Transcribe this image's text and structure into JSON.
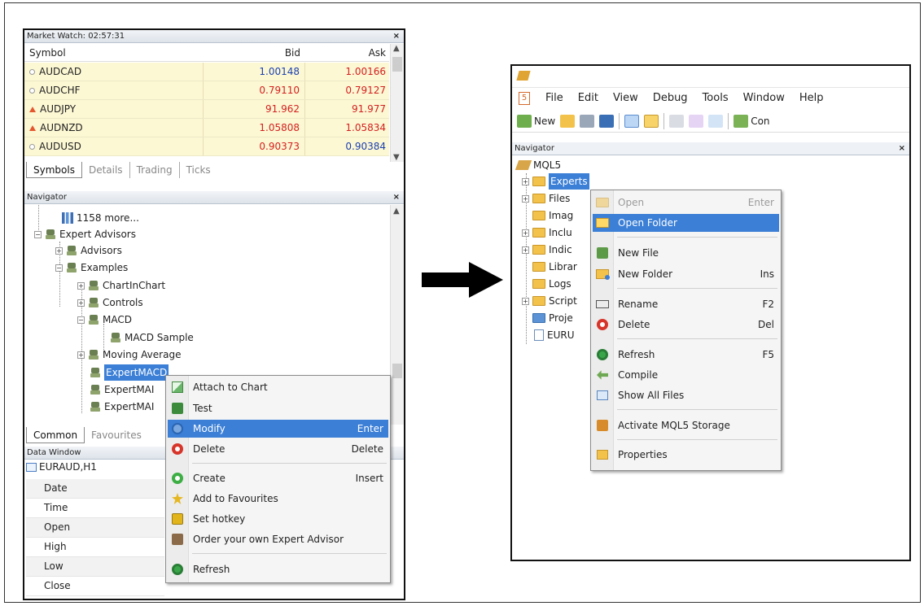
{
  "left": {
    "market_watch": {
      "title": "Market Watch: 02:57:31",
      "close": "×",
      "columns": [
        "Symbol",
        "Bid",
        "Ask"
      ],
      "rows": [
        {
          "symbol": "AUDCAD",
          "bid": "1.00148",
          "ask": "1.00166",
          "bid_color": "#1a3fb0",
          "ask_color": "#d32020",
          "indicator": "neutral"
        },
        {
          "symbol": "AUDCHF",
          "bid": "0.79110",
          "ask": "0.79127",
          "bid_color": "#d32020",
          "ask_color": "#d32020",
          "indicator": "neutral"
        },
        {
          "symbol": "AUDJPY",
          "bid": "91.962",
          "ask": "91.977",
          "bid_color": "#d32020",
          "ask_color": "#d32020",
          "indicator": "up"
        },
        {
          "symbol": "AUDNZD",
          "bid": "1.05808",
          "ask": "1.05834",
          "bid_color": "#d32020",
          "ask_color": "#d32020",
          "indicator": "up"
        },
        {
          "symbol": "AUDUSD",
          "bid": "0.90373",
          "ask": "0.90384",
          "bid_color": "#d32020",
          "ask_color": "#1a3fb0",
          "indicator": "neutral"
        }
      ],
      "tabs": [
        "Symbols",
        "Details",
        "Trading",
        "Ticks"
      ],
      "active_tab": "Symbols"
    },
    "navigator": {
      "title": "Navigator",
      "close": "×",
      "tree": {
        "more": "1158 more...",
        "expert_advisors": "Expert Advisors",
        "advisors": "Advisors",
        "examples": "Examples",
        "chartinchart": "ChartInChart",
        "controls": "Controls",
        "macd": "MACD",
        "macd_sample": "MACD Sample",
        "moving_average": "Moving Average",
        "expertmacd": "ExpertMACD",
        "expertma1": "ExpertMAI",
        "expertma2": "ExpertMAI"
      },
      "tabs": [
        "Common",
        "Favourites"
      ]
    },
    "data_window": {
      "title": "Data Window",
      "symbol": "EURAUD,H1",
      "rows": [
        "Date",
        "Time",
        "Open",
        "High",
        "Low",
        "Close"
      ]
    },
    "context_menu": {
      "items": [
        {
          "label": "Attach to Chart",
          "key": "",
          "icon": "attach-chart-icon"
        },
        {
          "label": "Test",
          "key": "",
          "icon": "test-icon"
        },
        {
          "label": "Modify",
          "key": "Enter",
          "icon": "modify-icon",
          "highlighted": true
        },
        {
          "label": "Delete",
          "key": "Delete",
          "icon": "delete-icon"
        },
        {
          "label": "Create",
          "key": "Insert",
          "icon": "create-icon"
        },
        {
          "label": "Add to Favourites",
          "key": "",
          "icon": "favourites-icon"
        },
        {
          "label": "Set hotkey",
          "key": "",
          "icon": "hotkey-icon"
        },
        {
          "label": "Order your own Expert Advisor",
          "key": "",
          "icon": "order-icon"
        },
        {
          "label": "Refresh",
          "key": "",
          "icon": "refresh-icon"
        }
      ]
    }
  },
  "right": {
    "menubar": [
      "File",
      "Edit",
      "View",
      "Debug",
      "Tools",
      "Window",
      "Help"
    ],
    "toolbar": {
      "new_label": "New",
      "compile_label": "Con"
    },
    "navigator": {
      "title": "Navigator",
      "close": "×",
      "root": "MQL5",
      "items": [
        "Experts",
        "Files",
        "Imag",
        "Inclu",
        "Indic",
        "Librar",
        "Logs",
        "Script",
        "Proje",
        "EURU"
      ]
    },
    "context_menu": {
      "items": [
        {
          "label": "Open",
          "key": "Enter",
          "icon": "open-icon",
          "disabled": true
        },
        {
          "label": "Open Folder",
          "key": "",
          "icon": "open-folder-icon",
          "highlighted": true
        },
        {
          "label": "New File",
          "key": "",
          "icon": "new-file-icon"
        },
        {
          "label": "New Folder",
          "key": "Ins",
          "icon": "new-folder-icon"
        },
        {
          "label": "Rename",
          "key": "F2",
          "icon": "rename-icon"
        },
        {
          "label": "Delete",
          "key": "Del",
          "icon": "delete-icon"
        },
        {
          "label": "Refresh",
          "key": "F5",
          "icon": "refresh-icon"
        },
        {
          "label": "Compile",
          "key": "",
          "icon": "compile-icon"
        },
        {
          "label": "Show All Files",
          "key": "",
          "icon": "show-all-files-icon"
        },
        {
          "label": "Activate MQL5 Storage",
          "key": "",
          "icon": "storage-icon"
        },
        {
          "label": "Properties",
          "key": "",
          "icon": "properties-icon"
        }
      ]
    }
  }
}
